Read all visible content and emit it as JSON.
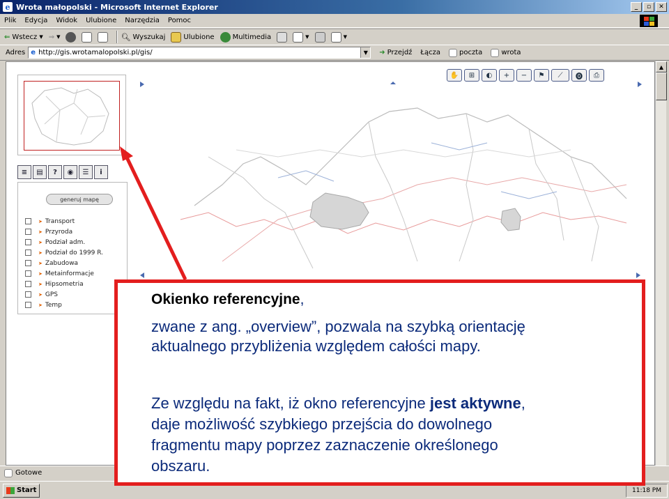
{
  "window": {
    "title": "Wrota małopolski - Microsoft Internet Explorer"
  },
  "menu": [
    "Plik",
    "Edycja",
    "Widok",
    "Ulubione",
    "Narzędzia",
    "Pomoc"
  ],
  "toolbar": {
    "back": "Wstecz",
    "search": "Wyszukaj",
    "favorites": "Ulubione",
    "multimedia": "Multimedia"
  },
  "address": {
    "label": "Adres",
    "url": "http://gis.wrotamalopolski.pl/gis/",
    "go": "Przejdź",
    "links": "Łącza",
    "mail": "poczta",
    "wrota": "wrota"
  },
  "panel": {
    "generate_button": "generuj mapę",
    "layers": [
      "Transport",
      "Przyroda",
      "Podział adm.",
      "Podział do 1999 R.",
      "Zabudowa",
      "Metainformacje",
      "Hipsometria",
      "GPS",
      "Temp"
    ]
  },
  "status": {
    "text": "Gotowe"
  },
  "taskbar": {
    "start": "Start",
    "clock": "11:18 PM"
  },
  "callout": {
    "title": "Okienko referencyjne",
    "title_comma": ",",
    "line1": "zwane z ang. „overview”, pozwala na szybką orientację",
    "line2": "aktualnego przybliżenia względem całości mapy.",
    "p2_line1_a": "Ze względu na fakt, iż okno referencyjne ",
    "p2_line1_bold": "jest aktywne",
    "p2_line1_b": ",",
    "p2_line2": "daje możliwość szybkiego przejścia do dowolnego",
    "p2_line3": "fragmentu mapy poprzez zaznaczenie określonego",
    "p2_line4": "obszaru."
  },
  "colors": {
    "callout_border": "#e31e1e",
    "callout_text": "#0b2a7a",
    "title_bar": "#0a246a"
  },
  "icons": [
    "ie-icon",
    "minimize-icon",
    "maximize-icon",
    "close-icon",
    "back-icon",
    "forward-icon",
    "stop-icon",
    "refresh-icon",
    "home-icon",
    "search-icon",
    "favorites-icon",
    "multimedia-icon",
    "history-icon",
    "mail-icon",
    "print-icon",
    "edit-icon",
    "go-icon",
    "pan-icon",
    "zoom-extent-icon",
    "zoom-in-icon",
    "zoom-out-icon",
    "identify-icon",
    "measure-icon",
    "print-map-icon"
  ]
}
